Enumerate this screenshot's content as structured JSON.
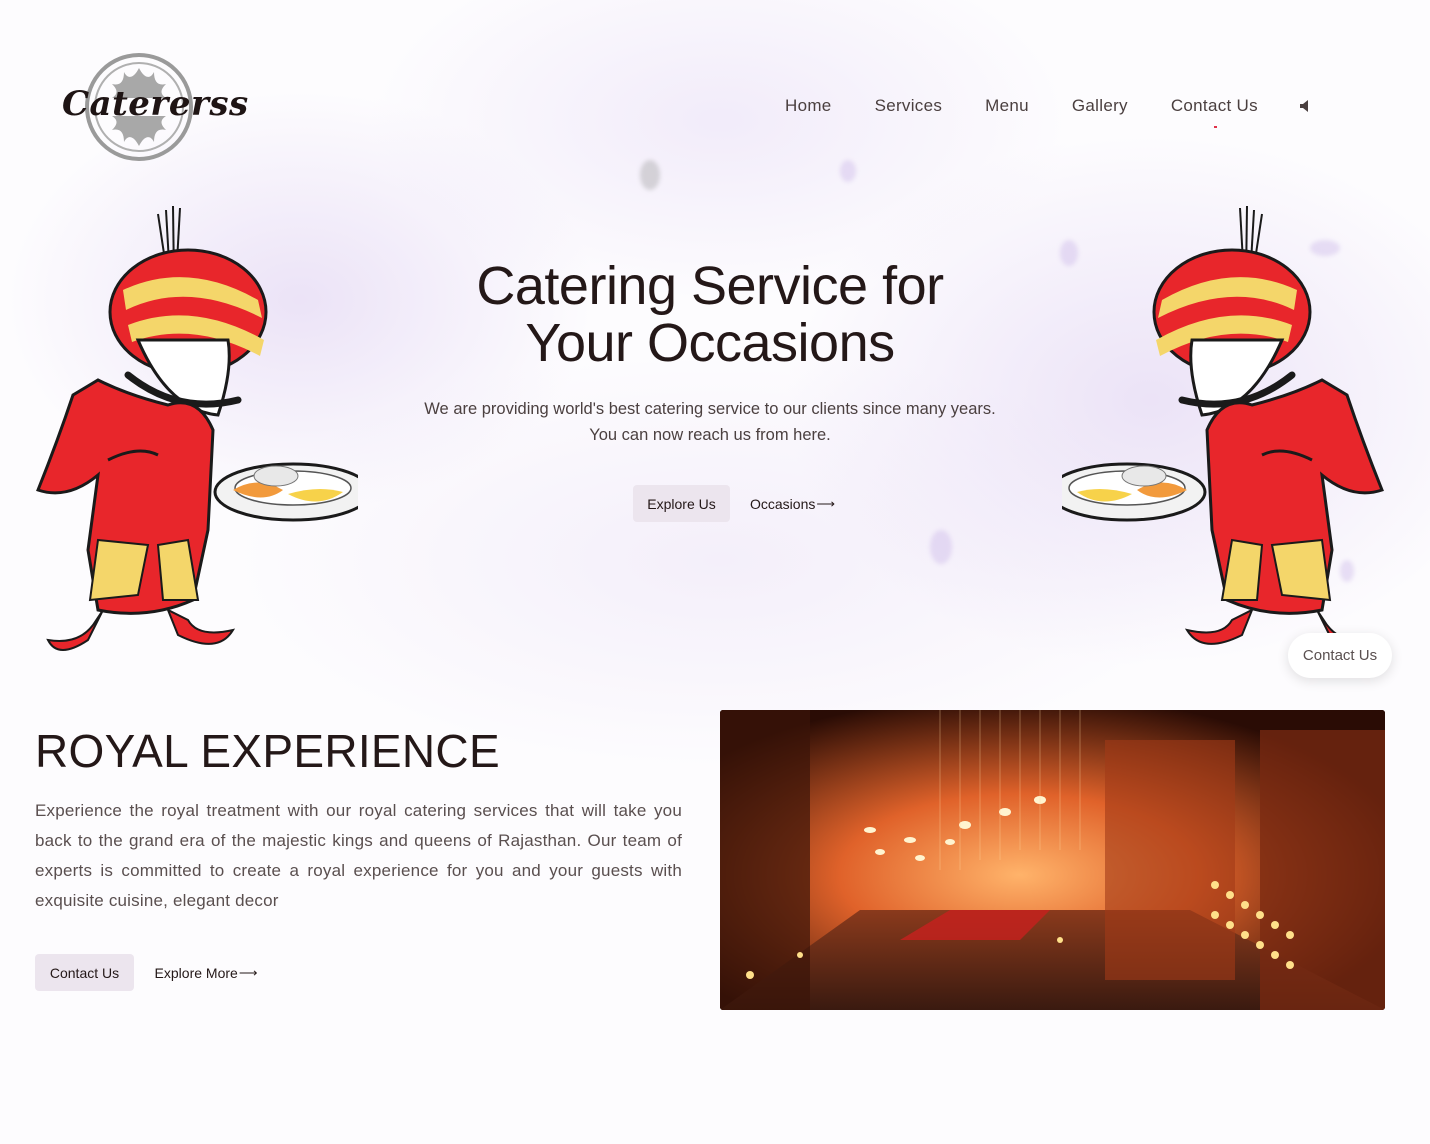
{
  "brand": {
    "logo_text": "Catererss"
  },
  "nav": {
    "items": [
      {
        "label": "Home"
      },
      {
        "label": "Services"
      },
      {
        "label": "Menu"
      },
      {
        "label": "Gallery"
      },
      {
        "label": "Contact Us"
      }
    ],
    "sound_icon": "speaker-icon"
  },
  "hero": {
    "title_line1": "Catering Service for",
    "title_line2": "Your Occasions",
    "subtitle": "We are providing world's best catering service to our clients since many years. You can now reach us from here.",
    "primary_button": "Explore Us",
    "secondary_button": "Occasions",
    "secondary_arrow": "⟶"
  },
  "floating_contact": {
    "label": "Contact Us"
  },
  "royal": {
    "title": "ROYAL EXPERIENCE",
    "text": "Experience the royal treatment with our royal catering services that will take you back to the grand era of the majestic kings and queens of Rajasthan. Our team of experts is committed to create a royal experience for you and your guests with exquisite cuisine, elegant decor",
    "primary_button": "Contact Us",
    "secondary_button": "Explore More",
    "secondary_arrow": "⟶"
  },
  "colors": {
    "accent_red": "#e0324b",
    "button_bg": "#ece5ee",
    "text_dark": "#241818",
    "mascot_red": "#e8262b",
    "mascot_yellow": "#f4d66a"
  }
}
